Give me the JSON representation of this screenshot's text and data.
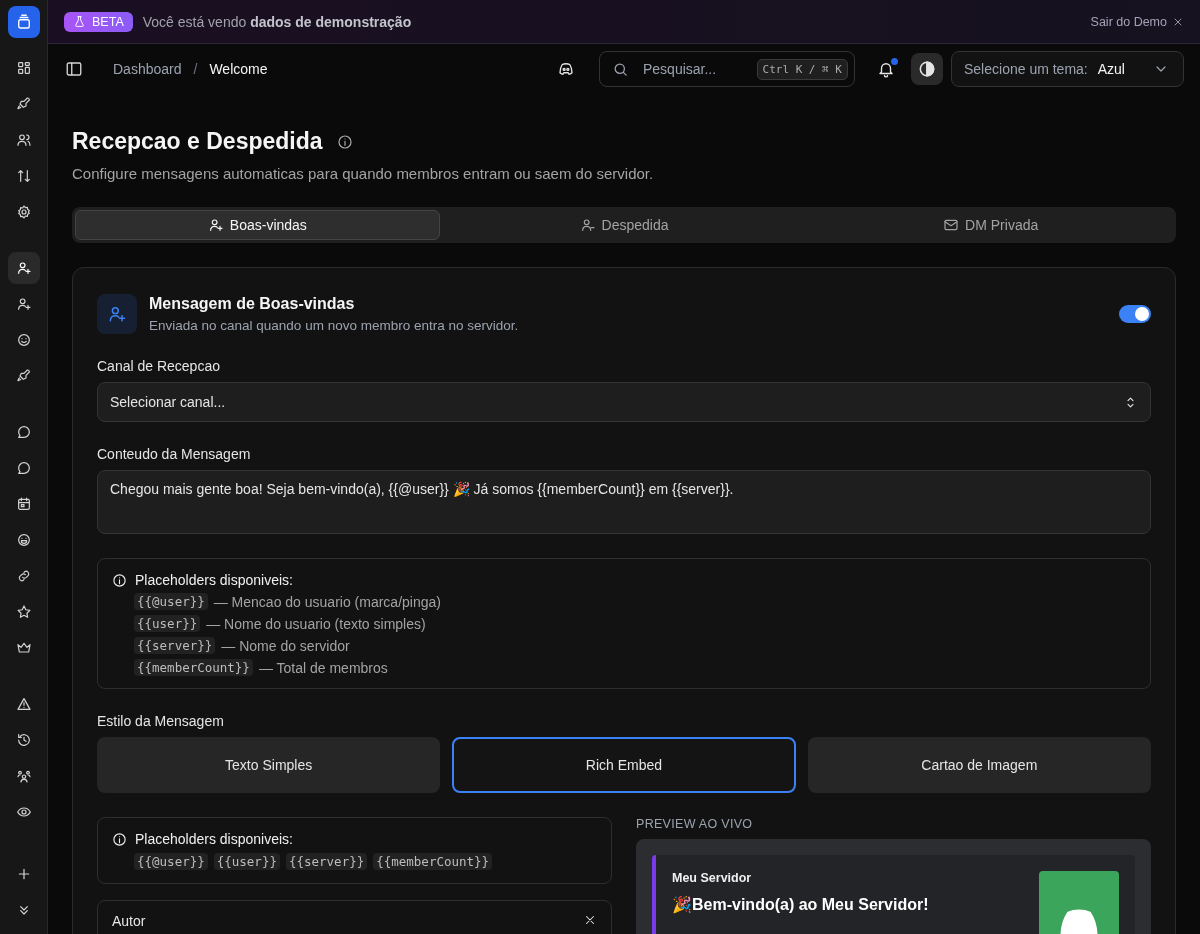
{
  "banner": {
    "badge": "BETA",
    "message": "Você está vendo **dados de demonstração**",
    "exit": "Sair do Demo"
  },
  "sidebar": {
    "groups": [
      {
        "items": [
          {
            "selected": false
          },
          {
            "selected": false
          },
          {
            "selected": false
          },
          {
            "selected": false
          },
          {
            "selected": false
          }
        ]
      },
      {
        "items": [
          {
            "selected": true
          },
          {
            "selected": false
          },
          {
            "selected": false
          },
          {
            "selected": false
          }
        ]
      },
      {
        "items": [
          {
            "selected": false
          },
          {
            "selected": false
          },
          {
            "selected": false
          },
          {
            "selected": false
          },
          {
            "selected": false
          },
          {
            "selected": false
          },
          {
            "selected": false
          }
        ]
      },
      {
        "items": [
          {
            "selected": false
          },
          {
            "selected": false
          },
          {
            "selected": false
          },
          {
            "selected": false
          }
        ]
      }
    ]
  },
  "header": {
    "breadcrumb": [
      "Dashboard",
      "Welcome"
    ],
    "breadcrumb_separator": "/",
    "search": {
      "placeholder": "Pesquisar...",
      "shortcut": "Ctrl K / ⌘ K"
    },
    "notifications": {
      "unread": true
    },
    "theme": {
      "label": "Selecione um tema:",
      "value": "Azul"
    }
  },
  "page": {
    "title": "Recepcao e Despedida",
    "subtitle": "Configure mensagens automaticas para quando membros entram ou saem do servidor."
  },
  "tabs": [
    {
      "label": "Boas-vindas",
      "selected": true
    },
    {
      "label": "Despedida",
      "selected": false
    },
    {
      "label": "DM Privada",
      "selected": false
    }
  ],
  "card": {
    "title": "Mensagem de Boas-vindas",
    "description": "Enviada no canal quando um novo membro entra no servidor.",
    "enabled": true,
    "channel": {
      "label": "Canal de Recepcao",
      "placeholder": "Selecionar canal..."
    },
    "message": {
      "label": "Conteudo da Mensagem",
      "value": "Chegou mais gente boa! Seja bem-vindo(a), {{@user}} 🎉 Já somos {{memberCount}} em {{server}}."
    },
    "placeholders": {
      "title": "Placeholders disponiveis:",
      "items": [
        {
          "token": "{{@user}}",
          "description": "— Mencao do usuario (marca/pinga)"
        },
        {
          "token": "{{user}}",
          "description": "— Nome do usuario (texto simples)"
        },
        {
          "token": "{{server}}",
          "description": "— Nome do servidor"
        },
        {
          "token": "{{memberCount}}",
          "description": "— Total de membros"
        }
      ]
    },
    "style": {
      "label": "Estilo da Mensagem",
      "options": [
        {
          "label": "Texto Simples",
          "selected": false
        },
        {
          "label": "Rich Embed",
          "selected": true
        },
        {
          "label": "Cartao de Imagem",
          "selected": false
        }
      ]
    },
    "compact_placeholders": {
      "title": "Placeholders disponiveis:",
      "tokens": [
        "{{@user}}",
        "{{user}}",
        "{{server}}",
        "{{memberCount}}"
      ]
    },
    "sections": [
      {
        "label": "Autor",
        "expanded": true
      }
    ],
    "preview": {
      "label": "PREVIEW AO VIVO",
      "author": "Meu Servidor",
      "title": "🎉Bem-vindo(a) ao Meu Servidor!"
    }
  }
}
